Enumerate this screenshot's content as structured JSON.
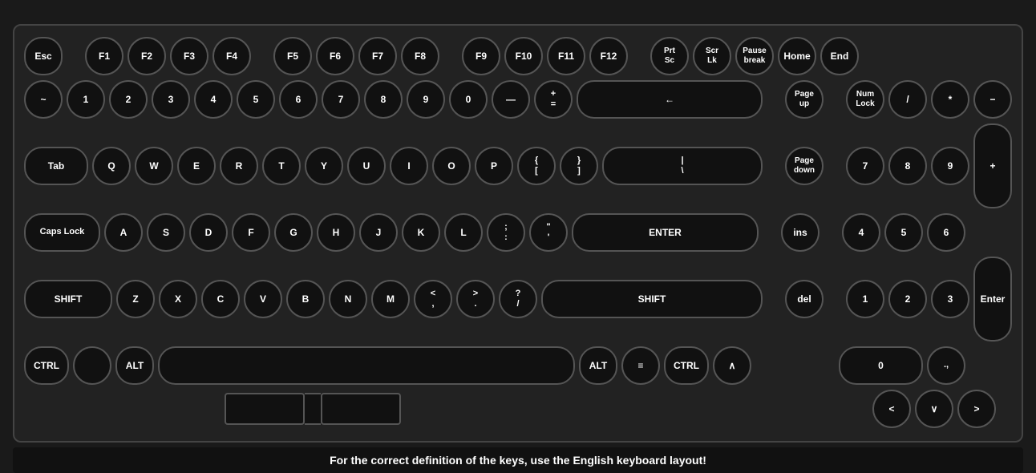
{
  "keyboard": {
    "rows": {
      "fn_row": [
        "Esc",
        "",
        "F1",
        "F2",
        "F3",
        "F4",
        "",
        "F5",
        "F6",
        "F7",
        "F8",
        "",
        "F9",
        "F10",
        "F11",
        "F12"
      ],
      "num_row": [
        "~",
        "1",
        "2",
        "3",
        "4",
        "5",
        "6",
        "7",
        "8",
        "9",
        "0",
        "—",
        "+\n=",
        "←"
      ],
      "tab_row": [
        "Tab",
        "Q",
        "W",
        "E",
        "R",
        "T",
        "Y",
        "U",
        "I",
        "O",
        "P",
        "{\n[",
        "}\n]",
        "|\n\\"
      ],
      "caps_row": [
        "Caps Lock",
        "A",
        "S",
        "D",
        "F",
        "G",
        "H",
        "J",
        "K",
        "L",
        ";\n:",
        "\"\n'",
        "ENTER"
      ],
      "shift_row": [
        "SHIFT",
        "Z",
        "X",
        "C",
        "V",
        "B",
        "N",
        "M",
        "<\n,",
        ">\n.",
        "?\n/",
        "SHIFT"
      ],
      "ctrl_row": [
        "CTRL",
        "",
        "ALT",
        "",
        "ALT",
        "≡",
        "CTRL",
        "∧"
      ]
    },
    "nav": {
      "top_row": [
        "Prt\nSc",
        "Scr\nLk",
        "Pause\nbreak",
        "Home",
        "End"
      ],
      "mid_row": [
        "Page\nup"
      ],
      "bot_row": [
        "Page\ndown"
      ],
      "nav2_row": [
        "ins"
      ],
      "nav3_row": [
        "del"
      ]
    },
    "numpad": {
      "row1": [
        "Num\nLock",
        "/",
        "*",
        "−"
      ],
      "row2": [
        "7",
        "8",
        "9"
      ],
      "row3": [
        "4",
        "5",
        "6"
      ],
      "row4": [
        "1",
        "2",
        "3"
      ],
      "row5": [
        "0"
      ],
      "plus": "+",
      "enter": "Enter"
    },
    "bottom_text": "For the correct definition of the keys, use the English keyboard layout!",
    "touchpad": {
      "left": "",
      "right": ""
    },
    "arrows": {
      "left": "<",
      "down": "∨",
      "right": ">"
    }
  }
}
